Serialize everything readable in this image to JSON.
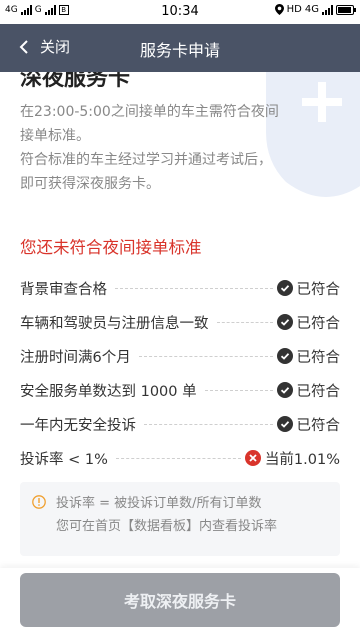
{
  "status_bar": {
    "left_text_1": "4G",
    "left_text_2": "G",
    "sim_label": "B",
    "time": "10:34",
    "right_text": "HD",
    "net_text": "4G"
  },
  "nav": {
    "back_label": "关闭",
    "title": "服务卡申请"
  },
  "content": {
    "partial_title": "深夜服务卡",
    "intro_lines": [
      "在23:00-5:00之间接单的车主需符合夜间",
      "接单标准。",
      "符合标准的车主经过学习并通过考试后，",
      "即可获得深夜服务卡。"
    ],
    "warning": "您还未符合夜间接单标准",
    "requirements": [
      {
        "label": "背景审查合格",
        "status": "已符合",
        "ok": true
      },
      {
        "label": "车辆和驾驶员与注册信息一致",
        "status": "已符合",
        "ok": true
      },
      {
        "label": "注册时间满6个月",
        "status": "已符合",
        "ok": true
      },
      {
        "label": "安全服务单数达到 1000 单",
        "status": "已符合",
        "ok": true
      },
      {
        "label": "一年内无安全投诉",
        "status": "已符合",
        "ok": true
      },
      {
        "label": "投诉率 < 1%",
        "status": "当前1.01%",
        "ok": false
      }
    ],
    "note_lines": [
      "投诉率 = 被投诉订单数/所有订单数",
      "您可在首页【数据看板】内查看投诉率"
    ]
  },
  "footer": {
    "button_label": "考取深夜服务卡"
  },
  "colors": {
    "nav_bg": "#4a5366",
    "warning_red": "#d9342b",
    "note_orange": "#f0a030",
    "button_disabled": "#9da0a6"
  }
}
